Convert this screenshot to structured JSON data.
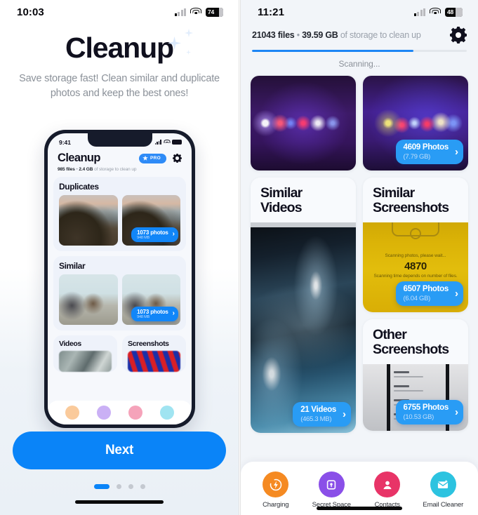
{
  "left": {
    "status": {
      "time": "10:03",
      "battery": "74",
      "wifi_icon": "wifi-icon",
      "cell_icon": "cellular-icon"
    },
    "hero": {
      "title": "Cleanup",
      "subtitle": "Save storage fast! Clean similar and duplicate photos and keep the best ones!"
    },
    "mockup": {
      "status": {
        "time": "9:41"
      },
      "title": "Cleanup",
      "pro_label": "PRO",
      "gear_icon": "gear-icon",
      "summary_files": "985 files",
      "summary_sep": " • ",
      "summary_size": "2.4 GB",
      "summary_tail": " of storage to clean up",
      "sections": [
        {
          "title": "Duplicates",
          "badge_count": "1073 photos",
          "badge_size": "948 MB"
        },
        {
          "title": "Similar",
          "badge_count": "1073 photos",
          "badge_size": "948 MB"
        }
      ],
      "mini_sections": [
        {
          "title": "Videos"
        },
        {
          "title": "Screenshots"
        }
      ]
    },
    "cta": {
      "next_label": "Next"
    },
    "pager": {
      "total": 4,
      "active": 0
    }
  },
  "right": {
    "status": {
      "time": "11:21",
      "battery": "48",
      "wifi_icon": "wifi-icon",
      "cell_icon": "cellular-icon"
    },
    "header": {
      "files": "21043 files",
      "sep": " • ",
      "size": "39.59 GB",
      "tail": " of storage to clean up",
      "gear_icon": "gear-icon",
      "progress_percent": 75,
      "scanning_label": "Scanning..."
    },
    "photo_row": {
      "badge_count": "4609 Photos",
      "badge_size": "(7.79 GB)"
    },
    "cards": {
      "similar_videos": {
        "title": "Similar Videos",
        "badge_count": "21 Videos",
        "badge_size": "(465.3 MB)"
      },
      "similar_screenshots": {
        "title": "Similar Screenshots",
        "overlay_line1": "Scanning photos, please wait...",
        "overlay_number": "4870",
        "overlay_line2": "Scanning time depends on number of files.",
        "badge_count": "6507 Photos",
        "badge_size": "(6.04 GB)"
      },
      "other_screenshots": {
        "title": "Other Screenshots",
        "badge_count": "6755 Photos",
        "badge_size": "(10.53 GB)"
      }
    },
    "tabbar": [
      {
        "label": "Charging",
        "icon": "charging-bolt-icon",
        "color": "#F58A22"
      },
      {
        "label": "Secret Space",
        "icon": "vault-lock-icon",
        "color": "#8A4FE8"
      },
      {
        "label": "Contacts",
        "icon": "contact-person-icon",
        "color": "#E83467"
      },
      {
        "label": "Email Cleaner",
        "icon": "envelope-icon",
        "color": "#2CC3E0"
      }
    ]
  }
}
